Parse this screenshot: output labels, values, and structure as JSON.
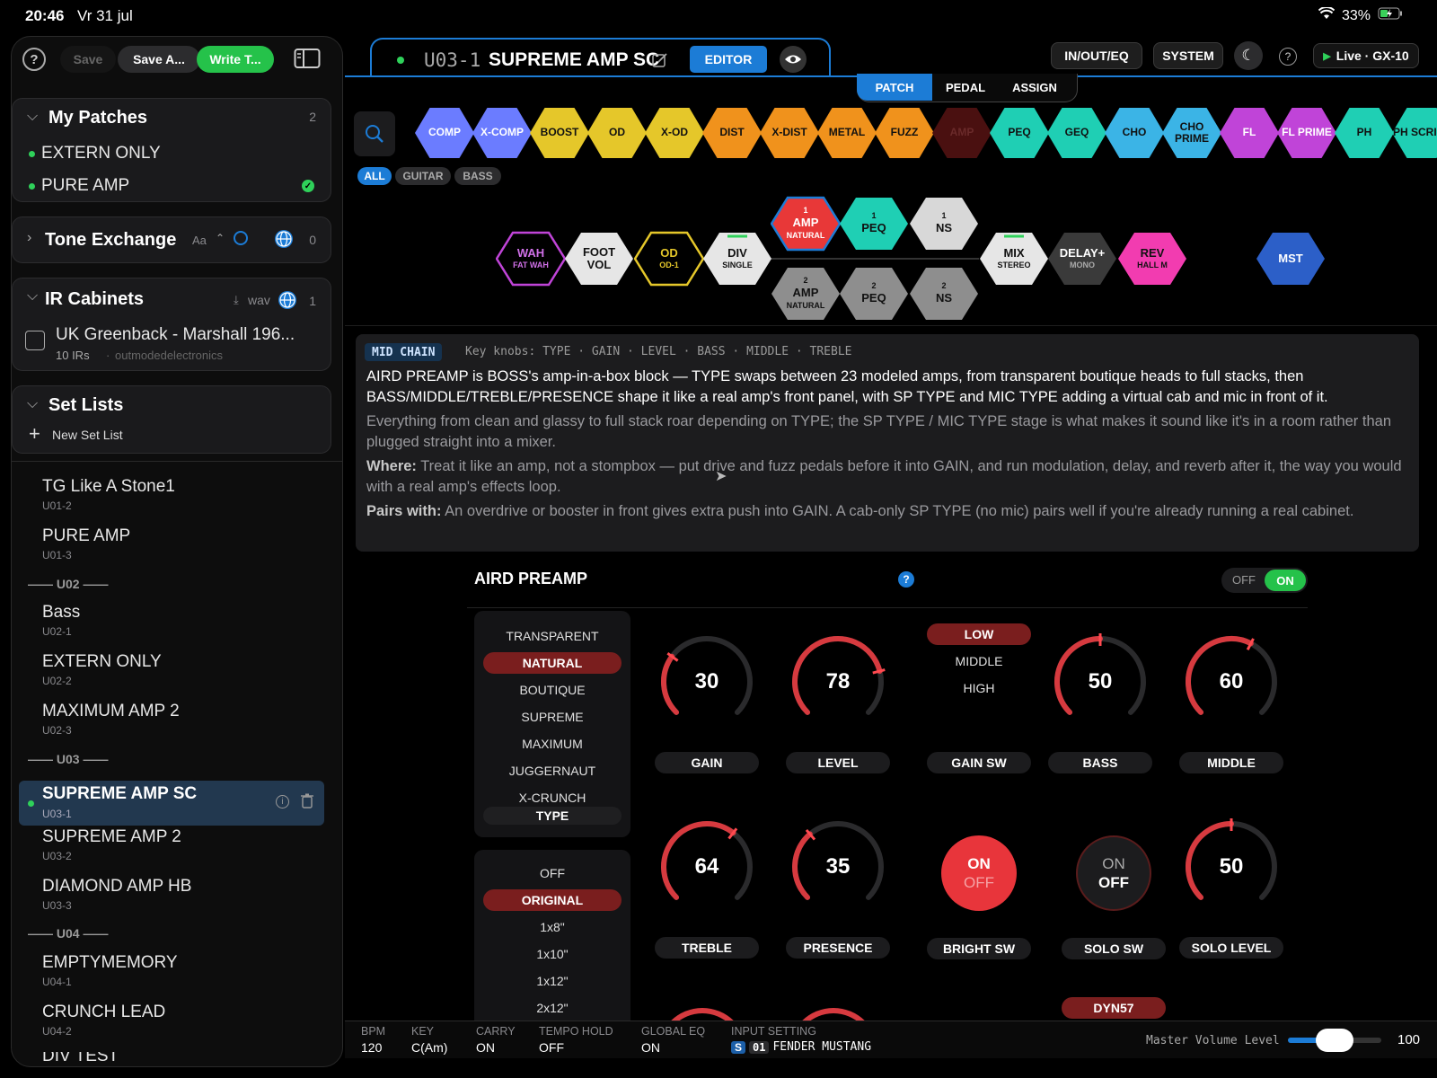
{
  "status": {
    "time": "20:46",
    "date": "Vr 31 jul",
    "battery": "33%"
  },
  "sidebar": {
    "save": "Save",
    "save_as": "Save A...",
    "write": "Write T...",
    "my_patches": {
      "title": "My Patches",
      "count": "2",
      "items": [
        "EXTERN ONLY",
        "PURE AMP"
      ]
    },
    "tone_exchange": {
      "title": "Tone Exchange",
      "sort": "Aa",
      "count": "0"
    },
    "ir_cabinets": {
      "title": "IR Cabinets",
      "format": "wav",
      "count": "1",
      "item_name": "UK Greenback - Marshall 196...",
      "item_count": "10 IRs",
      "item_author": "outmodedelectronics"
    },
    "set_lists": {
      "title": "Set Lists",
      "new": "New Set List"
    },
    "list": [
      {
        "name": "TG Like A Stone1",
        "code": "U01-2"
      },
      {
        "name": "PURE AMP",
        "code": "U01-3"
      },
      {
        "group": "U02"
      },
      {
        "name": "Bass",
        "code": "U02-1"
      },
      {
        "name": "EXTERN ONLY",
        "code": "U02-2"
      },
      {
        "name": "MAXIMUM AMP 2",
        "code": "U02-3"
      },
      {
        "group": "U03"
      },
      {
        "name": "SUPREME AMP SC",
        "code": "U03-1"
      },
      {
        "name": "SUPREME AMP 2",
        "code": "U03-2"
      },
      {
        "name": "DIAMOND AMP HB",
        "code": "U03-3"
      },
      {
        "group": "U04"
      },
      {
        "name": "EMPTYMEMORY",
        "code": "U04-1"
      },
      {
        "name": "CRUNCH LEAD",
        "code": "U04-2"
      },
      {
        "name": "DIV TEST",
        "code": ""
      }
    ]
  },
  "header": {
    "patch_code": "U03-1",
    "patch_name": "SUPREME AMP SC",
    "editor": "EDITOR",
    "inouteq": "IN/OUT/EQ",
    "system": "SYSTEM",
    "live": "Live · GX-10",
    "tabs": [
      "PATCH",
      "PEDAL",
      "ASSIGN"
    ]
  },
  "palette": [
    {
      "label": "COMP",
      "color": "#6b7cff"
    },
    {
      "label": "X-COMP",
      "color": "#6b7cff"
    },
    {
      "label": "BOOST",
      "color": "#e5c72a"
    },
    {
      "label": "OD",
      "color": "#e5c72a"
    },
    {
      "label": "X-OD",
      "color": "#e5c72a"
    },
    {
      "label": "DIST",
      "color": "#f0921c"
    },
    {
      "label": "X-DIST",
      "color": "#f0921c"
    },
    {
      "label": "METAL",
      "color": "#f0921c"
    },
    {
      "label": "FUZZ",
      "color": "#f0921c"
    },
    {
      "label": "AMP",
      "color": "#4a1010"
    },
    {
      "label": "PEQ",
      "color": "#1fcfb4"
    },
    {
      "label": "GEQ",
      "color": "#1fcfb4"
    },
    {
      "label": "CHO",
      "color": "#3bb4e6"
    },
    {
      "label": "CHO PRIME",
      "color": "#3bb4e6"
    },
    {
      "label": "FL",
      "color": "#c044d8"
    },
    {
      "label": "FL PRIME",
      "color": "#c044d8"
    },
    {
      "label": "PH",
      "color": "#1fcfb4"
    },
    {
      "label": "PH SCRIPT",
      "color": "#1fcfb4"
    }
  ],
  "filters": [
    "ALL",
    "GUITAR",
    "BASS"
  ],
  "chain": {
    "wah": {
      "label": "WAH",
      "sub": "FAT WAH"
    },
    "footvol": {
      "label": "FOOT VOL"
    },
    "od": {
      "label": "OD",
      "sub": "OD-1"
    },
    "div": {
      "label": "DIV",
      "sub": "SINGLE"
    },
    "amp1": {
      "num": "1",
      "label": "AMP",
      "sub": "NATURAL"
    },
    "peq1": {
      "num": "1",
      "label": "PEQ"
    },
    "ns1": {
      "num": "1",
      "label": "NS"
    },
    "amp2": {
      "num": "2",
      "label": "AMP",
      "sub": "NATURAL"
    },
    "peq2": {
      "num": "2",
      "label": "PEQ"
    },
    "ns2": {
      "num": "2",
      "label": "NS"
    },
    "mix": {
      "label": "MIX",
      "sub": "STEREO"
    },
    "delay": {
      "label": "DELAY+",
      "sub": "MONO"
    },
    "rev": {
      "label": "REV",
      "sub": "HALL M"
    },
    "mst": {
      "label": "MST"
    }
  },
  "info": {
    "tag": "MID CHAIN",
    "keyknobs": "Key knobs: TYPE · GAIN · LEVEL · BASS · MIDDLE · TREBLE",
    "desc": "AIRD PREAMP is BOSS's amp-in-a-box block — TYPE swaps between 23 modeled amps, from transparent boutique heads to full stacks, then BASS/MIDDLE/TREBLE/PRESENCE shape it like a real amp's front panel, with SP TYPE and MIC TYPE adding a virtual cab and mic in front of it.",
    "sound": "Everything from clean and glassy to full stack roar depending on TYPE; the SP TYPE / MIC TYPE stage is what makes it sound like it's in a room rather than plugged straight into a mixer.",
    "where_label": "Where:",
    "where": "Treat it like an amp, not a stompbox — put drive and fuzz pedals before it into GAIN, and run modulation, delay, and reverb after it, the way you would with a real amp's effects loop.",
    "pairs_label": "Pairs with:",
    "pairs": "An overdrive or booster in front gives extra push into GAIN. A cab-only SP TYPE (no mic) pairs well if you're already running a real cabinet."
  },
  "block": {
    "title": "AIRD PREAMP",
    "off": "OFF",
    "on": "ON",
    "types": [
      "TRANSPARENT",
      "NATURAL",
      "BOUTIQUE",
      "SUPREME",
      "MAXIMUM",
      "JUGGERNAUT",
      "X-CRUNCH"
    ],
    "type_label": "TYPE",
    "sp_types": [
      "OFF",
      "ORIGINAL",
      "1x8\"",
      "1x10\"",
      "1x12\"",
      "2x12\""
    ],
    "gain_sw": [
      "LOW",
      "MIDDLE",
      "HIGH"
    ],
    "knobs": [
      {
        "label": "GAIN",
        "value": 30,
        "fraction": 0.3
      },
      {
        "label": "LEVEL",
        "value": 78,
        "fraction": 0.78
      },
      {
        "label": "BASS",
        "value": 50,
        "fraction": 0.5
      },
      {
        "label": "MIDDLE",
        "value": 60,
        "fraction": 0.6
      },
      {
        "label": "TREBLE",
        "value": 64,
        "fraction": 0.64
      },
      {
        "label": "PRESENCE",
        "value": 35,
        "fraction": 0.35
      },
      {
        "label": "SOLO LEVEL",
        "value": 50,
        "fraction": 0.5
      }
    ],
    "gain_sw_label": "GAIN SW",
    "bright": {
      "label": "BRIGHT SW",
      "on": "ON",
      "off": "OFF"
    },
    "solo": {
      "label": "SOLO SW",
      "on": "ON",
      "off": "OFF"
    },
    "mic": "DYN57"
  },
  "bottom": {
    "bpm_k": "BPM",
    "bpm_v": "120",
    "key_k": "KEY",
    "key_v": "C(Am)",
    "carry_k": "CARRY",
    "carry_v": "ON",
    "tempo_k": "TEMPO HOLD",
    "tempo_v": "OFF",
    "geq_k": "GLOBAL EQ",
    "geq_v": "ON",
    "input_k": "INPUT SETTING",
    "input_s": "S",
    "input_n": "01",
    "input_v": "FENDER MUSTANG",
    "master_k": "Master Volume Level",
    "master_v": "100",
    "master_fraction": 0.5
  }
}
